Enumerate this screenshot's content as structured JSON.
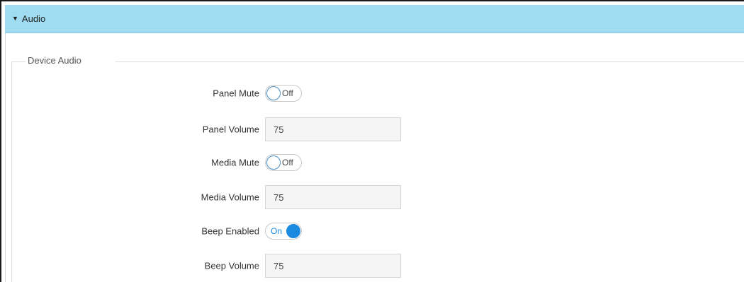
{
  "section": {
    "title": "Audio",
    "caret": "▼"
  },
  "fieldset": {
    "legend": "Device Audio"
  },
  "rows": [
    {
      "label": "Panel Mute",
      "type": "toggle",
      "state": "Off"
    },
    {
      "label": "Panel Volume",
      "type": "input",
      "value": "75"
    },
    {
      "label": "Media Mute",
      "type": "toggle",
      "state": "Off"
    },
    {
      "label": "Media Volume",
      "type": "input",
      "value": "75"
    },
    {
      "label": "Beep Enabled",
      "type": "toggle",
      "state": "On"
    },
    {
      "label": "Beep Volume",
      "type": "input",
      "value": "75"
    }
  ],
  "colors": {
    "header_bg": "#9fdcf1",
    "toggle_on": "#1a8ae0",
    "input_bg": "#f5f5f5"
  }
}
